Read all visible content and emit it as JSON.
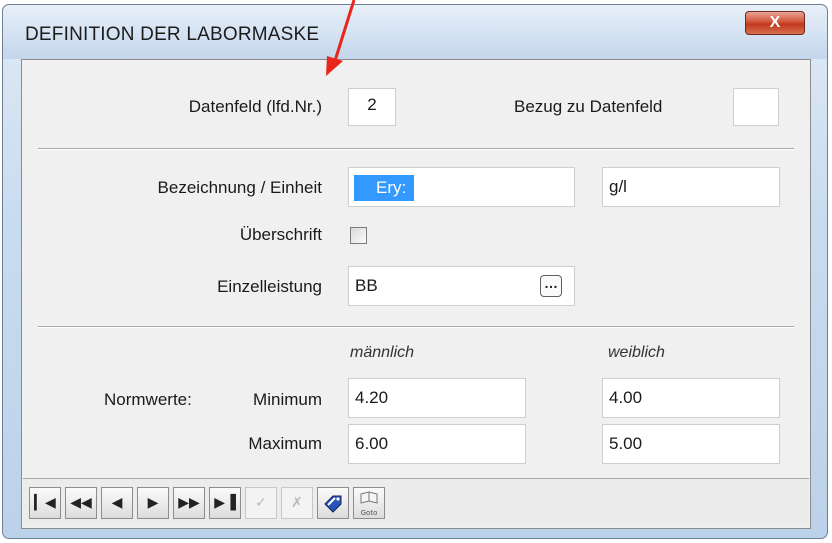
{
  "window": {
    "title": "DEFINITION DER LABORMASKE",
    "close_label": "X"
  },
  "row_datenfeld": {
    "label": "Datenfeld  (lfd.Nr.)",
    "value": "2",
    "bezug_label": "Bezug zu Datenfeld",
    "bezug_value": ""
  },
  "row_bezeichnung": {
    "label": "Bezeichnung / Einheit",
    "name_value": "Ery:",
    "unit_value": "g/l"
  },
  "row_ueberschrift": {
    "label": "Überschrift",
    "checked": false
  },
  "row_einzelleistung": {
    "label": "Einzelleistung",
    "value": "BB",
    "button_label": "…"
  },
  "normwerte": {
    "label": "Normwerte:",
    "col_male": "männlich",
    "col_female": "weiblich",
    "minimum_label": "Minimum",
    "maximum_label": "Maximum",
    "min_male": "4.20",
    "min_female": "4.00",
    "max_male": "6.00",
    "max_female": "5.00"
  },
  "toolbar": {
    "first_icon": "first-record-icon",
    "prev_page_icon": "rewind-icon",
    "prev_icon": "prev-record-icon",
    "next_icon": "next-record-icon",
    "next_page_icon": "fast-forward-icon",
    "last_icon": "last-record-icon",
    "confirm_icon": "checkmark-icon",
    "cancel_icon": "cancel-icon",
    "edit_icon": "edit-tag-icon",
    "goto_label": "Goto"
  },
  "annotation": {
    "arrow_color": "#e8261c"
  }
}
